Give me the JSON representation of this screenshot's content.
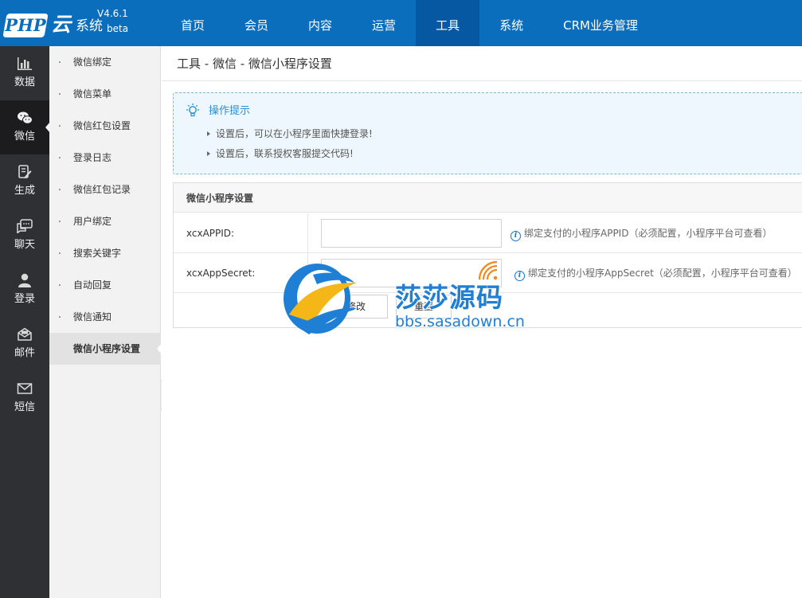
{
  "header": {
    "logo": {
      "php": "PHP",
      "yun": "云",
      "system": "系统",
      "beta": "beta",
      "version": "V4.6.1"
    },
    "nav": [
      {
        "label": "首页",
        "active": false
      },
      {
        "label": "会员",
        "active": false
      },
      {
        "label": "内容",
        "active": false
      },
      {
        "label": "运营",
        "active": false
      },
      {
        "label": "工具",
        "active": true
      },
      {
        "label": "系统",
        "active": false
      },
      {
        "label": "CRM业务管理",
        "active": false
      }
    ]
  },
  "iconbar": [
    {
      "label": "数据",
      "icon": "bar-chart-icon"
    },
    {
      "label": "微信",
      "icon": "wechat-icon",
      "active": true
    },
    {
      "label": "生成",
      "icon": "generate-icon"
    },
    {
      "label": "聊天",
      "icon": "chat-icon"
    },
    {
      "label": "登录",
      "icon": "user-icon"
    },
    {
      "label": "邮件",
      "icon": "mail-open-icon"
    },
    {
      "label": "短信",
      "icon": "envelope-icon"
    }
  ],
  "submenu": [
    {
      "label": "微信绑定"
    },
    {
      "label": "微信菜单"
    },
    {
      "label": "微信红包设置"
    },
    {
      "label": "登录日志"
    },
    {
      "label": "微信红包记录"
    },
    {
      "label": "用户绑定"
    },
    {
      "label": "搜索关键字"
    },
    {
      "label": "自动回复"
    },
    {
      "label": "微信通知"
    },
    {
      "label": "微信小程序设置",
      "active": true
    }
  ],
  "main": {
    "breadcrumb": "工具 - 微信 - 微信小程序设置",
    "tips": {
      "title": "操作提示",
      "items": [
        "设置后，可以在小程序里面快捷登录!",
        "设置后，联系授权客服提交代码!"
      ]
    },
    "panel": {
      "title": "微信小程序设置",
      "fields": [
        {
          "label": "xcxAPPID:",
          "value": "",
          "help": "绑定支付的小程序APPID（必须配置，小程序平台可查看）"
        },
        {
          "label": "xcxAppSecret:",
          "value": "",
          "help": "绑定支付的小程序AppSecret（必须配置，小程序平台可查看）"
        }
      ],
      "buttons": {
        "submit": "修改",
        "reset": "重置"
      }
    }
  },
  "watermark": {
    "cn": "莎莎源码",
    "en": "bbs.sasadown.cn"
  },
  "colors": {
    "header": "#0a6ebd",
    "header_active": "#0758a3",
    "sidebar": "#2f3033",
    "accent": "#2b8fd6"
  }
}
